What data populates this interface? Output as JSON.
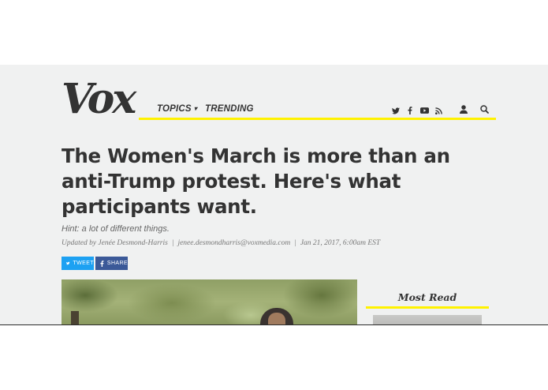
{
  "header": {
    "logo": "Vox",
    "nav": {
      "topics_label": "TOPICS",
      "trending_label": "TRENDING"
    },
    "icons": [
      "twitter-icon",
      "facebook-icon",
      "youtube-icon",
      "rss-icon",
      "user-icon",
      "search-icon"
    ],
    "accent_color": "#fff200"
  },
  "article": {
    "headline": "The Women's March is more than an anti-Trump protest. Here's what participants want.",
    "dek": "Hint: a lot of different things.",
    "byline": {
      "prefix": "Updated by Jenée Desmond-Harris",
      "email": "jenee.desmondharris@voxmedia.com",
      "date": "Jan 21, 2017, 6:00am EST"
    },
    "share": {
      "tweet_label": "TWEET",
      "share_label": "SHARE"
    }
  },
  "sidebar": {
    "most_read_title": "Most Read"
  },
  "colors": {
    "tweet": "#1da1f2",
    "facebook": "#3b5998",
    "text": "#333333",
    "page_background": "#f0f1f1"
  }
}
